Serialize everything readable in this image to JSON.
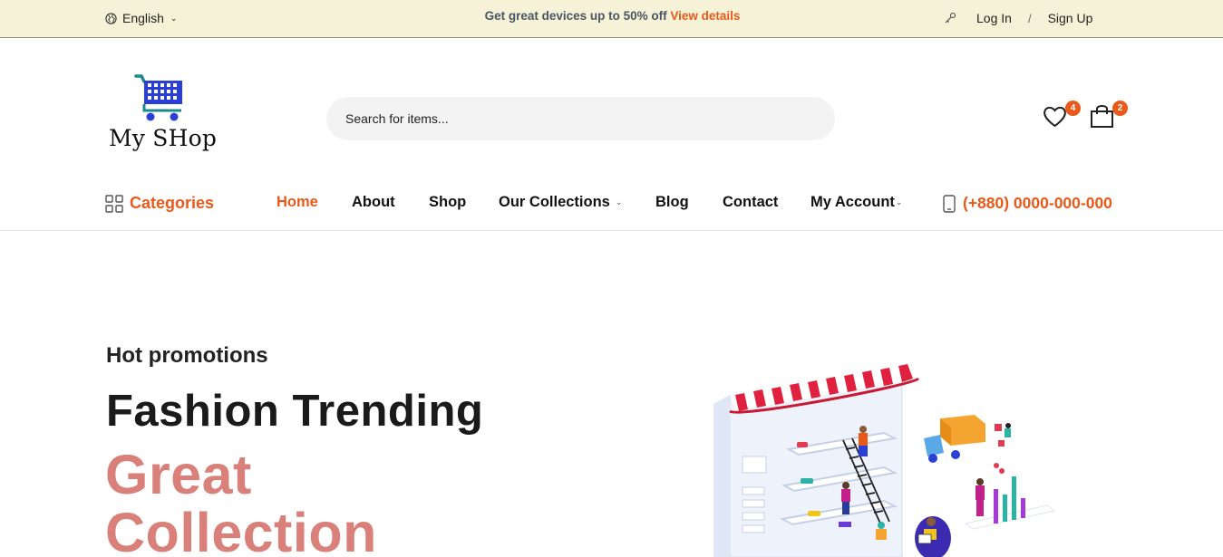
{
  "topbar": {
    "language": "English",
    "promo_text": "Get great devices up to 50% off",
    "promo_link": "View details",
    "login": "Log In",
    "separator": "/",
    "signup": "Sign Up"
  },
  "header": {
    "logo_text": "My SHop",
    "search_placeholder": "Search for items...",
    "wishlist_count": "4",
    "cart_count": "2"
  },
  "nav": {
    "categories": "Categories",
    "items": [
      {
        "label": "Home",
        "active": true
      },
      {
        "label": "About"
      },
      {
        "label": "Shop"
      },
      {
        "label": "Our Collections",
        "dropdown": true
      },
      {
        "label": "Blog"
      },
      {
        "label": "Contact"
      },
      {
        "label": "My Account",
        "dropdown": true
      }
    ],
    "phone": "(+880) 0000-000-000"
  },
  "hero": {
    "kicker": "Hot promotions",
    "title": "Fashion Trending",
    "highlight": "Great Collection"
  },
  "colors": {
    "accent": "#e8591a",
    "topbar_bg": "#f6f2d7",
    "highlight": "#d88079"
  },
  "icons": [
    "globe-icon",
    "chevron-down-icon",
    "key-icon",
    "cart-logo-icon",
    "heart-icon",
    "shopping-bag-icon",
    "grid-icon",
    "phone-icon"
  ]
}
